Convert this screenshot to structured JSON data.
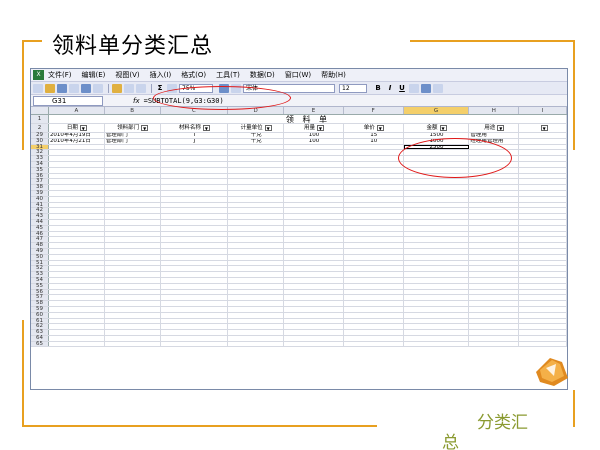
{
  "slide": {
    "title": "领料单分类汇总",
    "bottom_label_line1": "分类汇",
    "bottom_label_line2": "总",
    "accent_color": "#e8a020",
    "bottom_label_color": "#8a9a30",
    "back_button_icon": "return-arrow-icon"
  },
  "excel": {
    "menu": [
      "文件(F)",
      "编辑(E)",
      "视图(V)",
      "插入(I)",
      "格式(O)",
      "工具(T)",
      "数据(D)",
      "窗口(W)",
      "帮助(H)"
    ],
    "toolbar": {
      "zoom": "75%",
      "font": "宋体",
      "font_size": "12",
      "bold": "B",
      "italic": "I",
      "underline": "U",
      "sigma": "Σ"
    },
    "name_box": "G31",
    "fx_label": "fx",
    "formula": "=SUBTOTAL(9,G3:G30)",
    "columns": [
      "A",
      "B",
      "C",
      "D",
      "E",
      "F",
      "G",
      "H",
      "I"
    ],
    "selected_column": "G",
    "sheet_title": "领 料 单",
    "headers": [
      "日期",
      "领料部门",
      "材料名称",
      "计量单位",
      "用量",
      "单价",
      "金额",
      "用途",
      ""
    ],
    "data_rows": [
      {
        "num": "29",
        "cells": [
          "2010年4月19日",
          "管理部门",
          "I",
          "千克",
          "100",
          "15",
          "1500",
          "管理用",
          ""
        ]
      },
      {
        "num": "30",
        "cells": [
          "2010年4月21日",
          "管理部门",
          "J",
          "千克",
          "100",
          "10",
          "1000",
          "经理用管理用",
          ""
        ]
      },
      {
        "num": "31",
        "cells": [
          "",
          "",
          "",
          "",
          "",
          "",
          "2500",
          "",
          ""
        ]
      }
    ],
    "empty_rows_start": 32,
    "empty_rows_end": 65
  }
}
